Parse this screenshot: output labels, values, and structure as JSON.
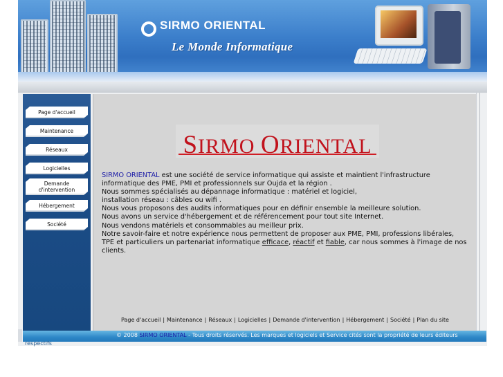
{
  "header": {
    "brand": "SIRMO ORIENTAL",
    "tagline": "Le Monde Informatique"
  },
  "sidebar": {
    "items": [
      {
        "label": "Page d'accueil"
      },
      {
        "label": "Maintenance"
      },
      {
        "label": "Réseaux"
      },
      {
        "label": "Logicielles"
      },
      {
        "label": "Demande d'intervention"
      },
      {
        "label": "Hébergement"
      },
      {
        "label": "Société"
      }
    ]
  },
  "main": {
    "logo_first_letter": "S",
    "logo_word1_rest": "IRMO ",
    "logo_second_letter": "O",
    "logo_word2_rest": "RIENTAL",
    "description": {
      "company": "SIRMO ORIENTAL",
      "line1_rest": " est une société de service informatique qui assiste et maintient l'infrastructure",
      "line2": "informatique des PME, PMI et professionnels sur Oujda et la région .",
      "line3": "Nous sommes spécialisés au dépannage informatique : matériel et logiciel,",
      "line4": "installation réseau : câbles ou wifi .",
      "line5": " Nous vous proposons des audits informatiques pour en définir ensemble la meilleure solution.",
      "line6": "Nous avons un service d'hébergement et de référencement pour tout site Internet.",
      "line7": " Nous vendons matériels et consommables au meilleur prix.",
      "line8": " Notre savoir-faire et notre expérience nous permettent de proposer aux PME, PMI, professions libérales,",
      "line9_start": "TPE et particuliers un partenariat informatique ",
      "w_efficace": "efficace",
      "sep1": ", ",
      "w_reactif": "réactif",
      "sep2": " et ",
      "w_fiable": "fiable",
      "line9_end": ", car nous sommes à l'image de nos",
      "line10": "clients."
    }
  },
  "footer": {
    "links": [
      "Page d'accueil",
      "Maintenance",
      "Réseaux",
      "Logicielles",
      "Demande d'intervention",
      "Hébergement",
      "Société",
      "Plan du site"
    ],
    "separator": "|",
    "copyright_start": "© 2008 ",
    "copyright_company": "SIRMO ORIENTAL",
    "copyright_end": " - Tous droits réservés. Les marques et logiciels et Service cités sont la propriété de leurs éditeurs",
    "copyright_wrap": "respectifs"
  },
  "colors": {
    "banner_blue": "#3c7fcb",
    "sidebar_blue": "#1d4d88",
    "logo_red": "#c1121c",
    "link_blue": "#1a1aa6",
    "footer_bar": "#2d87c7"
  }
}
